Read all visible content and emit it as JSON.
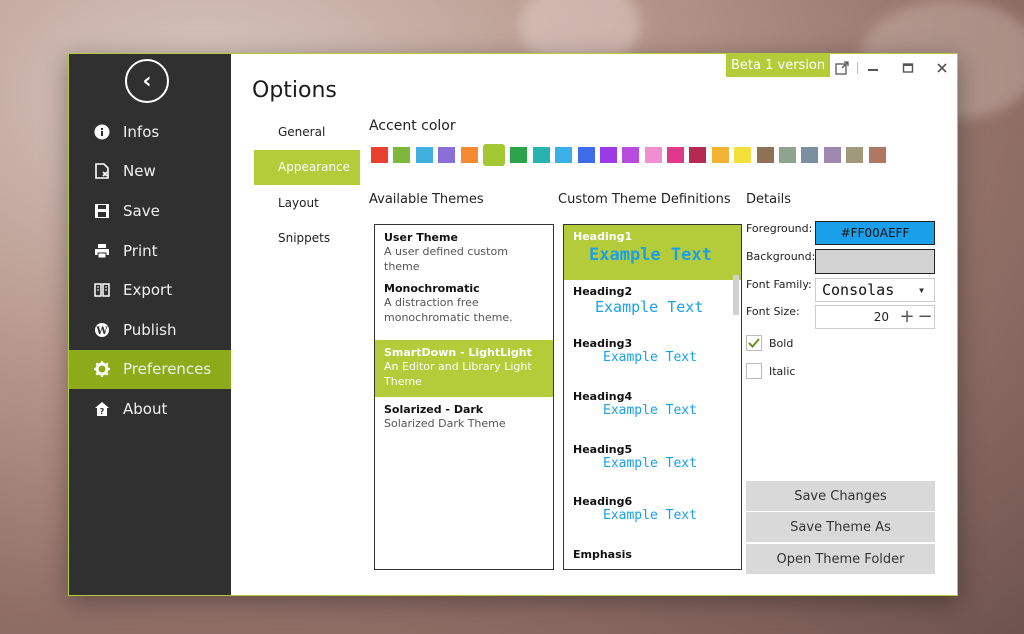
{
  "window": {
    "title": "Options",
    "badge": "Beta 1 version",
    "accent": "#b5cc3a"
  },
  "sidebar": {
    "back_icon": "back-arrow-icon",
    "items": [
      {
        "label": "Infos",
        "icon": "info-icon"
      },
      {
        "label": "New",
        "icon": "new-document-icon"
      },
      {
        "label": "Save",
        "icon": "save-icon"
      },
      {
        "label": "Print",
        "icon": "print-icon"
      },
      {
        "label": "Export",
        "icon": "export-icon"
      },
      {
        "label": "Publish",
        "icon": "wordpress-icon"
      },
      {
        "label": "Preferences",
        "icon": "gear-icon",
        "active": true
      },
      {
        "label": "About",
        "icon": "about-icon"
      }
    ]
  },
  "tabs": [
    {
      "label": "General"
    },
    {
      "label": "Appearance",
      "active": true
    },
    {
      "label": "Layout"
    },
    {
      "label": "Snippets"
    }
  ],
  "accent_color": {
    "label": "Accent color",
    "swatches": [
      "#e8412f",
      "#7cb83b",
      "#3fb0e0",
      "#8b6fd6",
      "#f58a33",
      "#a2c833",
      "#2ca24a",
      "#27b3b0",
      "#3bb0e8",
      "#3d6ce8",
      "#9b3be8",
      "#b94be0",
      "#f08fd0",
      "#e0388a",
      "#b52a52",
      "#f2b233",
      "#f5df3a",
      "#8f7254",
      "#8fa38e",
      "#7a8fa0",
      "#9f88b0",
      "#a09a7a",
      "#b07862"
    ],
    "selected_index": 5
  },
  "available_themes": {
    "label": "Available Themes",
    "items": [
      {
        "name": "User Theme",
        "desc": "A user defined custom theme"
      },
      {
        "name": "Monochromatic",
        "desc": "A distraction free monochromatic theme."
      },
      {
        "name": "SmartDown - LightLight",
        "desc": "An Editor and Library Light Theme",
        "selected": true
      },
      {
        "name": "Solarized - Dark",
        "desc": "Solarized Dark Theme"
      }
    ]
  },
  "theme_definitions": {
    "label": "Custom Theme Definitions",
    "items": [
      {
        "name": "Heading1",
        "sample": "Example Text",
        "selected": true
      },
      {
        "name": "Heading2",
        "sample": "Example Text"
      },
      {
        "name": "Heading3",
        "sample": "Example Text"
      },
      {
        "name": "Heading4",
        "sample": "Example Text"
      },
      {
        "name": "Heading5",
        "sample": "Example Text"
      },
      {
        "name": "Heading6",
        "sample": "Example Text"
      },
      {
        "name": "Emphasis",
        "sample": ""
      }
    ]
  },
  "details": {
    "label": "Details",
    "foreground_label": "Foreground:",
    "foreground_value": "#FF00AEFF",
    "foreground_color": "#1aa0ea",
    "background_label": "Background:",
    "background_color": "#d3d3d3",
    "font_family_label": "Font Family:",
    "font_family_value": "Consolas",
    "font_size_label": "Font Size:",
    "font_size_value": "20",
    "bold_label": "Bold",
    "bold_checked": true,
    "italic_label": "Italic",
    "italic_checked": false
  },
  "actions": {
    "save_changes": "Save Changes",
    "save_theme_as": "Save Theme As",
    "open_theme_folder": "Open Theme Folder"
  }
}
